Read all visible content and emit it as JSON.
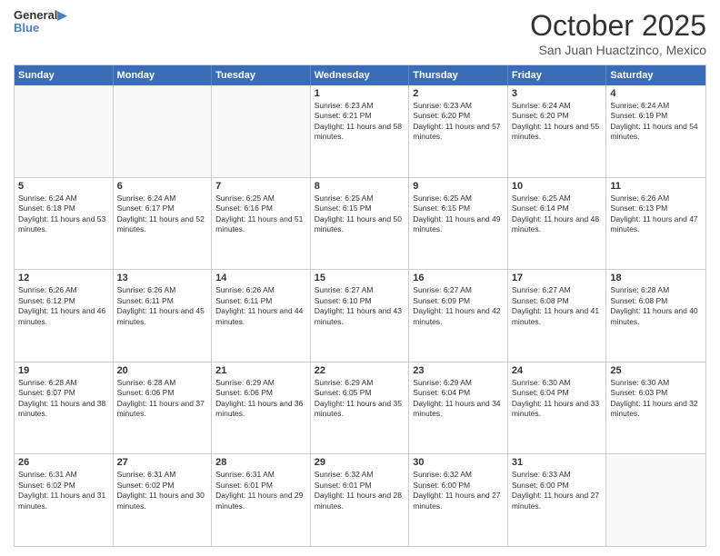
{
  "logo": {
    "general": "General",
    "blue": "Blue"
  },
  "title": "October 2025",
  "subtitle": "San Juan Huactzinco, Mexico",
  "header_days": [
    "Sunday",
    "Monday",
    "Tuesday",
    "Wednesday",
    "Thursday",
    "Friday",
    "Saturday"
  ],
  "weeks": [
    [
      {
        "day": "",
        "sunrise": "",
        "sunset": "",
        "daylight": ""
      },
      {
        "day": "",
        "sunrise": "",
        "sunset": "",
        "daylight": ""
      },
      {
        "day": "",
        "sunrise": "",
        "sunset": "",
        "daylight": ""
      },
      {
        "day": "1",
        "sunrise": "Sunrise: 6:23 AM",
        "sunset": "Sunset: 6:21 PM",
        "daylight": "Daylight: 11 hours and 58 minutes."
      },
      {
        "day": "2",
        "sunrise": "Sunrise: 6:23 AM",
        "sunset": "Sunset: 6:20 PM",
        "daylight": "Daylight: 11 hours and 57 minutes."
      },
      {
        "day": "3",
        "sunrise": "Sunrise: 6:24 AM",
        "sunset": "Sunset: 6:20 PM",
        "daylight": "Daylight: 11 hours and 55 minutes."
      },
      {
        "day": "4",
        "sunrise": "Sunrise: 6:24 AM",
        "sunset": "Sunset: 6:19 PM",
        "daylight": "Daylight: 11 hours and 54 minutes."
      }
    ],
    [
      {
        "day": "5",
        "sunrise": "Sunrise: 6:24 AM",
        "sunset": "Sunset: 6:18 PM",
        "daylight": "Daylight: 11 hours and 53 minutes."
      },
      {
        "day": "6",
        "sunrise": "Sunrise: 6:24 AM",
        "sunset": "Sunset: 6:17 PM",
        "daylight": "Daylight: 11 hours and 52 minutes."
      },
      {
        "day": "7",
        "sunrise": "Sunrise: 6:25 AM",
        "sunset": "Sunset: 6:16 PM",
        "daylight": "Daylight: 11 hours and 51 minutes."
      },
      {
        "day": "8",
        "sunrise": "Sunrise: 6:25 AM",
        "sunset": "Sunset: 6:15 PM",
        "daylight": "Daylight: 11 hours and 50 minutes."
      },
      {
        "day": "9",
        "sunrise": "Sunrise: 6:25 AM",
        "sunset": "Sunset: 6:15 PM",
        "daylight": "Daylight: 11 hours and 49 minutes."
      },
      {
        "day": "10",
        "sunrise": "Sunrise: 6:25 AM",
        "sunset": "Sunset: 6:14 PM",
        "daylight": "Daylight: 11 hours and 48 minutes."
      },
      {
        "day": "11",
        "sunrise": "Sunrise: 6:26 AM",
        "sunset": "Sunset: 6:13 PM",
        "daylight": "Daylight: 11 hours and 47 minutes."
      }
    ],
    [
      {
        "day": "12",
        "sunrise": "Sunrise: 6:26 AM",
        "sunset": "Sunset: 6:12 PM",
        "daylight": "Daylight: 11 hours and 46 minutes."
      },
      {
        "day": "13",
        "sunrise": "Sunrise: 6:26 AM",
        "sunset": "Sunset: 6:11 PM",
        "daylight": "Daylight: 11 hours and 45 minutes."
      },
      {
        "day": "14",
        "sunrise": "Sunrise: 6:26 AM",
        "sunset": "Sunset: 6:11 PM",
        "daylight": "Daylight: 11 hours and 44 minutes."
      },
      {
        "day": "15",
        "sunrise": "Sunrise: 6:27 AM",
        "sunset": "Sunset: 6:10 PM",
        "daylight": "Daylight: 11 hours and 43 minutes."
      },
      {
        "day": "16",
        "sunrise": "Sunrise: 6:27 AM",
        "sunset": "Sunset: 6:09 PM",
        "daylight": "Daylight: 11 hours and 42 minutes."
      },
      {
        "day": "17",
        "sunrise": "Sunrise: 6:27 AM",
        "sunset": "Sunset: 6:08 PM",
        "daylight": "Daylight: 11 hours and 41 minutes."
      },
      {
        "day": "18",
        "sunrise": "Sunrise: 6:28 AM",
        "sunset": "Sunset: 6:08 PM",
        "daylight": "Daylight: 11 hours and 40 minutes."
      }
    ],
    [
      {
        "day": "19",
        "sunrise": "Sunrise: 6:28 AM",
        "sunset": "Sunset: 6:07 PM",
        "daylight": "Daylight: 11 hours and 38 minutes."
      },
      {
        "day": "20",
        "sunrise": "Sunrise: 6:28 AM",
        "sunset": "Sunset: 6:06 PM",
        "daylight": "Daylight: 11 hours and 37 minutes."
      },
      {
        "day": "21",
        "sunrise": "Sunrise: 6:29 AM",
        "sunset": "Sunset: 6:06 PM",
        "daylight": "Daylight: 11 hours and 36 minutes."
      },
      {
        "day": "22",
        "sunrise": "Sunrise: 6:29 AM",
        "sunset": "Sunset: 6:05 PM",
        "daylight": "Daylight: 11 hours and 35 minutes."
      },
      {
        "day": "23",
        "sunrise": "Sunrise: 6:29 AM",
        "sunset": "Sunset: 6:04 PM",
        "daylight": "Daylight: 11 hours and 34 minutes."
      },
      {
        "day": "24",
        "sunrise": "Sunrise: 6:30 AM",
        "sunset": "Sunset: 6:04 PM",
        "daylight": "Daylight: 11 hours and 33 minutes."
      },
      {
        "day": "25",
        "sunrise": "Sunrise: 6:30 AM",
        "sunset": "Sunset: 6:03 PM",
        "daylight": "Daylight: 11 hours and 32 minutes."
      }
    ],
    [
      {
        "day": "26",
        "sunrise": "Sunrise: 6:31 AM",
        "sunset": "Sunset: 6:02 PM",
        "daylight": "Daylight: 11 hours and 31 minutes."
      },
      {
        "day": "27",
        "sunrise": "Sunrise: 6:31 AM",
        "sunset": "Sunset: 6:02 PM",
        "daylight": "Daylight: 11 hours and 30 minutes."
      },
      {
        "day": "28",
        "sunrise": "Sunrise: 6:31 AM",
        "sunset": "Sunset: 6:01 PM",
        "daylight": "Daylight: 11 hours and 29 minutes."
      },
      {
        "day": "29",
        "sunrise": "Sunrise: 6:32 AM",
        "sunset": "Sunset: 6:01 PM",
        "daylight": "Daylight: 11 hours and 28 minutes."
      },
      {
        "day": "30",
        "sunrise": "Sunrise: 6:32 AM",
        "sunset": "Sunset: 6:00 PM",
        "daylight": "Daylight: 11 hours and 27 minutes."
      },
      {
        "day": "31",
        "sunrise": "Sunrise: 6:33 AM",
        "sunset": "Sunset: 6:00 PM",
        "daylight": "Daylight: 11 hours and 27 minutes."
      },
      {
        "day": "",
        "sunrise": "",
        "sunset": "",
        "daylight": ""
      }
    ]
  ]
}
